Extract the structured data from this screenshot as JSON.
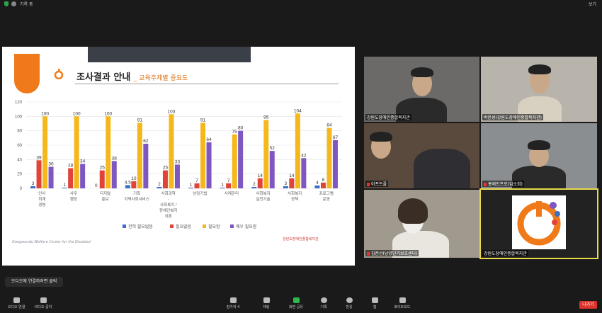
{
  "topbar": {
    "recording": "기록 중",
    "view_label": "보기"
  },
  "slide": {
    "title": "조사결과 안내",
    "subtitle": "_ 교육주제별 중요도",
    "footer": "Gangwondo Welfare Center for the Disabled",
    "logo_text": "강원도장애인종합복지관"
  },
  "chart_data": {
    "type": "bar",
    "categories": [
      "인사\n회계\n경영",
      "사무\n행정",
      "디지털\n홍보",
      "기획\n지역사회서비스",
      "사회과학\n-\n사회복지 /\n장애인복지\n이론",
      "상담기법",
      "사례관리",
      "사회복지\n실천기술",
      "사회복지\n정책",
      "프로그램\n운영"
    ],
    "series": [
      {
        "name": "전혀 필요없음",
        "color": "#3d6fc4",
        "values": [
          3,
          1,
          0,
          4.5,
          2,
          1,
          1,
          2,
          3,
          4
        ]
      },
      {
        "name": "필요없음",
        "color": "#e0433a",
        "values": [
          39,
          28,
          25,
          10,
          25,
          7,
          7,
          14,
          14,
          8
        ]
      },
      {
        "name": "필요함",
        "color": "#f5b81c",
        "values": [
          100,
          100,
          100,
          91,
          103,
          91,
          75,
          95,
          104,
          84
        ]
      },
      {
        "name": "매우 필요함",
        "color": "#7e57c2",
        "values": [
          30,
          34,
          38,
          62,
          33,
          64,
          80,
          52,
          42,
          67
        ]
      }
    ],
    "value_labels": [
      [
        "3",
        "1",
        "0",
        "4.5",
        "2",
        "1",
        "1",
        "2",
        "3",
        "4"
      ],
      [
        "39",
        "28",
        "25",
        "10",
        "25",
        "7",
        "7",
        "14",
        "14",
        "8"
      ],
      [
        "100",
        "100",
        "100",
        "91",
        "103",
        "91",
        "75",
        "95",
        "104",
        "84"
      ],
      [
        "30",
        "34",
        "38",
        "62",
        "33",
        "64",
        "80",
        "52",
        "42",
        "67"
      ]
    ],
    "yticks": [
      0,
      20,
      40,
      60,
      80,
      100,
      120
    ],
    "ylim": [
      0,
      120
    ],
    "legend": "bottom"
  },
  "participants": [
    {
      "name": "강원도장애인종합복지관",
      "muted": false
    },
    {
      "name": "박윤성(강원도장애인종합복지관)",
      "muted": false
    },
    {
      "name": "아프트플",
      "muted": true
    },
    {
      "name": "홍애인프로(김소희)",
      "muted": true
    },
    {
      "name": "김준선(남양단기보호센터)",
      "muted": true
    },
    {
      "name": "강원도장애인종합복지관",
      "muted": false
    }
  ],
  "audio_prompt": "오디오에 연결하려면 클릭",
  "toolbar": [
    {
      "label": "오디오 연결",
      "icon": "headphones-icon"
    },
    {
      "label": "비디오 중지",
      "icon": "video-camera-icon"
    },
    {
      "label": "참가자 4",
      "icon": "participants-icon"
    },
    {
      "label": "채팅",
      "icon": "chat-icon"
    },
    {
      "label": "화면 공유",
      "icon": "share-screen-icon"
    },
    {
      "label": "기록",
      "icon": "record-icon"
    },
    {
      "label": "반응",
      "icon": "reaction-icon"
    },
    {
      "label": "앱",
      "icon": "apps-icon"
    },
    {
      "label": "화이트보드",
      "icon": "whiteboard-icon"
    }
  ],
  "leave_label": "나가기"
}
